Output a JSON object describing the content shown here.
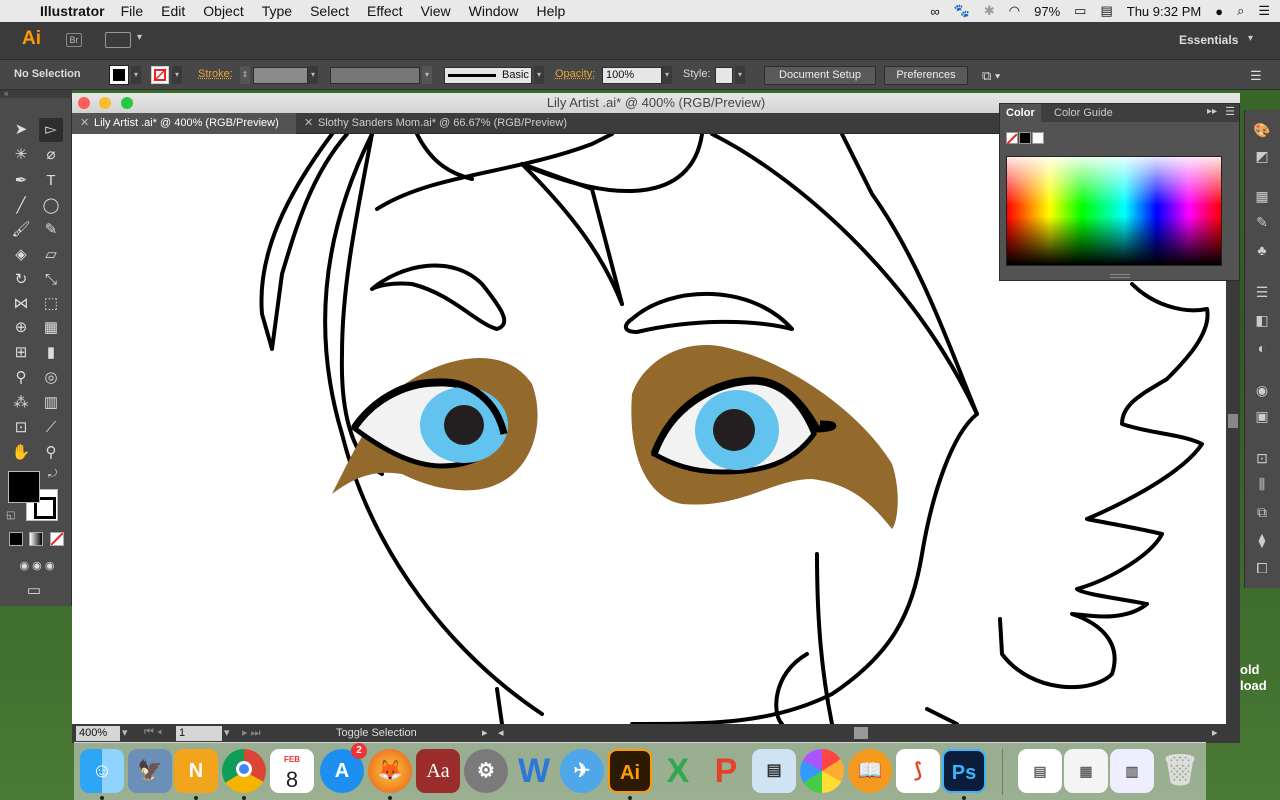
{
  "menubar": {
    "app_name": "Illustrator",
    "menus": [
      "File",
      "Edit",
      "Object",
      "Type",
      "Select",
      "Effect",
      "View",
      "Window",
      "Help"
    ],
    "battery": "97%",
    "clock": "Thu 9:32 PM"
  },
  "appbar": {
    "logo": "Ai",
    "bridge": "Br",
    "workspace": "Essentials"
  },
  "control": {
    "selection": "No Selection",
    "stroke_label": "Stroke:",
    "brush_label": "Basic",
    "opacity_label": "Opacity:",
    "opacity_value": "100%",
    "style_label": "Style:",
    "doc_setup": "Document Setup",
    "preferences": "Preferences"
  },
  "document": {
    "window_title": "Lily Artist .ai* @ 400% (RGB/Preview)",
    "tabs": [
      {
        "label": "Lily Artist .ai* @ 400% (RGB/Preview)"
      },
      {
        "label": "Slothy Sanders Mom.ai* @ 66.67% (RGB/Preview)"
      }
    ],
    "zoom": "400%",
    "page": "1",
    "status": "Toggle Selection"
  },
  "color_panel": {
    "tab_color": "Color",
    "tab_guide": "Color Guide"
  },
  "artwork": {
    "eyeshadow": "#936a2c",
    "iris": "#62c3ef",
    "pupil": "#231f20",
    "sclera": "#f2f2f2"
  },
  "dock": {
    "apps": [
      "Finder",
      "Preview",
      "Notability",
      "Chrome",
      "Calendar",
      "App Store",
      "Firefox",
      "Dictionary",
      "System Preferences",
      "Word",
      "Mail",
      "Illustrator",
      "Excel",
      "PowerPoint",
      "Preview Photos",
      "Photos",
      "iBooks",
      "Acrobat",
      "Photoshop",
      "Document",
      "Screenshot",
      "Downloads",
      "Trash"
    ],
    "calendar_month": "FEB",
    "calendar_day": "8",
    "appstore_badge": "2"
  },
  "desktop_text": "old\nload"
}
